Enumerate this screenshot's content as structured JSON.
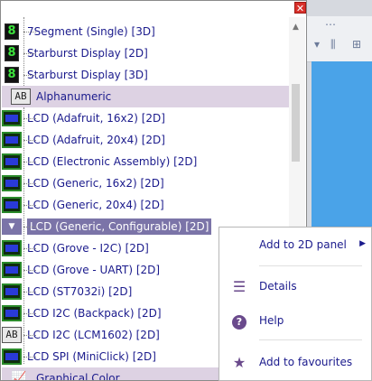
{
  "tree": {
    "items": [
      {
        "label": "7Segment (Single) [3D]",
        "icon": "seven-segment-icon",
        "glyph": "8"
      },
      {
        "label": "Starburst Display [2D]",
        "icon": "starburst-icon",
        "glyph": "8"
      },
      {
        "label": "Starburst Display [3D]",
        "icon": "starburst-icon",
        "glyph": "8"
      },
      {
        "label": "Alphanumeric",
        "icon": "alphanumeric-icon",
        "glyph": "AB",
        "category": true
      },
      {
        "label": "LCD (Adafruit, 16x2) [2D]",
        "icon": "lcd-icon"
      },
      {
        "label": "LCD (Adafruit, 20x4) [2D]",
        "icon": "lcd-icon"
      },
      {
        "label": "LCD (Electronic Assembly) [2D]",
        "icon": "lcd-icon"
      },
      {
        "label": "LCD (Generic, 16x2) [2D]",
        "icon": "lcd-icon"
      },
      {
        "label": "LCD (Generic, 20x4) [2D]",
        "icon": "lcd-icon"
      },
      {
        "label": "LCD (Generic, Configurable) [2D]",
        "icon": "dropdown-arrow-icon",
        "selected": true
      },
      {
        "label": "LCD (Grove - I2C) [2D]",
        "icon": "lcd-icon"
      },
      {
        "label": "LCD (Grove - UART) [2D]",
        "icon": "lcd-icon"
      },
      {
        "label": "LCD (ST7032i) [2D]",
        "icon": "lcd-icon"
      },
      {
        "label": "LCD I2C (Backpack) [2D]",
        "icon": "lcd-icon"
      },
      {
        "label": "LCD I2C (LCM1602) [2D]",
        "icon": "alphanumeric-icon",
        "glyph": "AB"
      },
      {
        "label": "LCD SPI (MiniClick) [2D]",
        "icon": "lcd-icon"
      },
      {
        "label": "Graphical Color",
        "icon": "graph-icon",
        "category": true
      }
    ]
  },
  "context_menu": {
    "add_to_panel": "Add to 2D panel",
    "details": "Details",
    "help": "Help",
    "add_favourites": "Add to favourites"
  },
  "close_glyph": "✕"
}
